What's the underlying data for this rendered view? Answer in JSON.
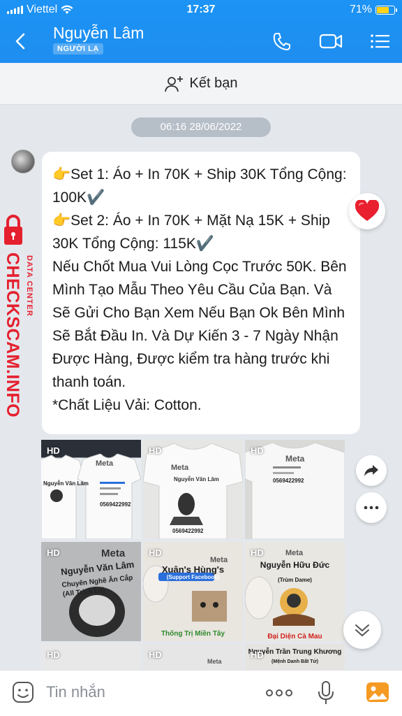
{
  "status_bar": {
    "carrier": "Viettel",
    "time": "17:37",
    "battery": "71%",
    "battery_level": 0.71
  },
  "header": {
    "name": "Nguyễn Lâm",
    "badge": "NGƯỜI LẠ"
  },
  "friend_bar": {
    "label": "Kết bạn"
  },
  "date_pill": "06:16 28/06/2022",
  "message": {
    "lines": [
      "👉Set 1: Áo + In 70K + Ship 30K Tổng Cộng: 100K✔️",
      "👉Set 2: Áo + In 70K + Mặt Nạ 15K + Ship 30K Tổng Cộng: 115K✔️",
      "Nếu Chốt Mua Vui Lòng Cọc Trước 50K. Bên Mình Tạo Mẫu Theo Yêu Cầu Của Bạn. Và Sẽ Gửi Cho Bạn Xem Nếu Bạn Ok Bên Mình Sẽ Bắt Đầu In. Và Dự Kiến 3 - 7 Ngày Nhận Được Hàng, Được kiểm tra hàng trước khi thanh toán.",
      "*Chất Liệu Vải: Cotton."
    ],
    "reaction": "heart"
  },
  "watermark": {
    "brand": "CHECKSCAM.INFO",
    "sub": "DATA CENTER"
  },
  "photos": [
    {
      "badge": "HD",
      "brand": "Meta",
      "name": "Nguyễn Văn Lâm",
      "phone": "0569422992"
    },
    {
      "badge": "HD",
      "brand": "Meta",
      "name": "Nguyễn Văn Lâm",
      "phone": "0569422992"
    },
    {
      "badge": "HD",
      "brand": "Meta",
      "phone": "0569422992"
    },
    {
      "badge": "HD",
      "brand": "Meta",
      "name": "Nguyễn Văn Lâm",
      "tagline": "Chuyên Nghề Ăn Cắp (All Trick Lỏ)"
    },
    {
      "badge": "HD",
      "brand": "Meta",
      "name": "Xuân's Hùng's",
      "tag": "(Support Facebook)",
      "footer": "Thống Trị Miền Tây"
    },
    {
      "badge": "HD",
      "brand": "Meta",
      "name": "Nguyễn Hữu Đức",
      "tag": "(Trùm Dame)",
      "footer": "Đại Diện Cà Mau"
    },
    {
      "badge": "HD"
    },
    {
      "badge": "HD",
      "brand": "Meta"
    },
    {
      "badge": "HD",
      "name": "Nguyễn Trần Trung Khương",
      "tag": "(Mệnh Danh Bất Tử)"
    }
  ],
  "composer": {
    "placeholder": "Tin nhắn"
  },
  "icons": [
    "back-icon",
    "phone-icon",
    "video-call-icon",
    "menu-icon",
    "add-friend-icon",
    "heart-icon",
    "share-icon",
    "more-icon",
    "scroll-down-icon",
    "sticker-icon",
    "more-dots-icon",
    "mic-icon",
    "image-icon"
  ],
  "colors": {
    "header": "#1e8ef0",
    "accent_red": "#e5202e",
    "background": "#e4e8ed"
  }
}
